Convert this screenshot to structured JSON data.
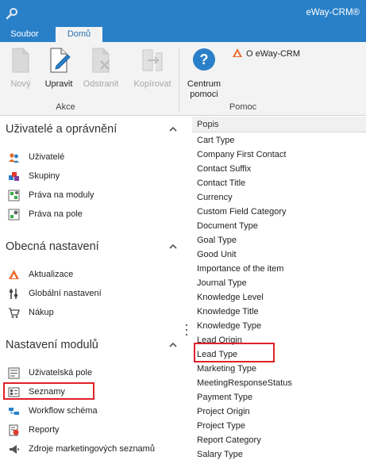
{
  "titlebar": {
    "title": "eWay-CRM®",
    "icon": "wrench-gear-icon"
  },
  "tabs": {
    "file": "Soubor",
    "home": "Domů"
  },
  "ribbon": {
    "actions": {
      "new": "Nový",
      "edit": "Upravit",
      "delete": "Odstranit",
      "copy": "Kopírovat",
      "group_label": "Akce"
    },
    "help": {
      "center_line1": "Centrum",
      "center_line2": "pomoci",
      "about": "O eWay-CRM",
      "group_label": "Pomoc"
    }
  },
  "sidebar": {
    "sections": [
      {
        "title": "Uživatelé a oprávnění",
        "items": [
          {
            "label": "Uživatelé",
            "icon": "users-icon"
          },
          {
            "label": "Skupiny",
            "icon": "groups-icon"
          },
          {
            "label": "Práva na moduly",
            "icon": "module-permissions-icon"
          },
          {
            "label": "Práva na pole",
            "icon": "field-permissions-icon"
          }
        ]
      },
      {
        "title": "Obecná nastavení",
        "items": [
          {
            "label": "Aktualizace",
            "icon": "update-icon"
          },
          {
            "label": "Globální nastavení",
            "icon": "settings-icon"
          },
          {
            "label": "Nákup",
            "icon": "cart-icon"
          }
        ]
      },
      {
        "title": "Nastavení modulů",
        "items": [
          {
            "label": "Uživatelská pole",
            "icon": "custom-fields-icon"
          },
          {
            "label": "Seznamy",
            "icon": "lists-icon"
          },
          {
            "label": "Workflow schéma",
            "icon": "workflow-icon"
          },
          {
            "label": "Reporty",
            "icon": "reports-icon"
          },
          {
            "label": "Zdroje marketingových seznamů",
            "icon": "marketing-sources-icon"
          }
        ]
      }
    ]
  },
  "list": {
    "column_header": "Popis",
    "rows": [
      "Cart Type",
      "Company First Contact",
      "Contact Suffix",
      "Contact Title",
      "Currency",
      "Custom Field Category",
      "Document Type",
      "Goal Type",
      "Good Unit",
      "Importance of the item",
      "Journal Type",
      "Knowledge Level",
      "Knowledge Title",
      "Knowledge Type",
      "Lead Origin",
      "Lead Type",
      "Marketing Type",
      "MeetingResponseStatus",
      "Payment Type",
      "Project Origin",
      "Project Type",
      "Report Category",
      "Salary Type"
    ]
  }
}
